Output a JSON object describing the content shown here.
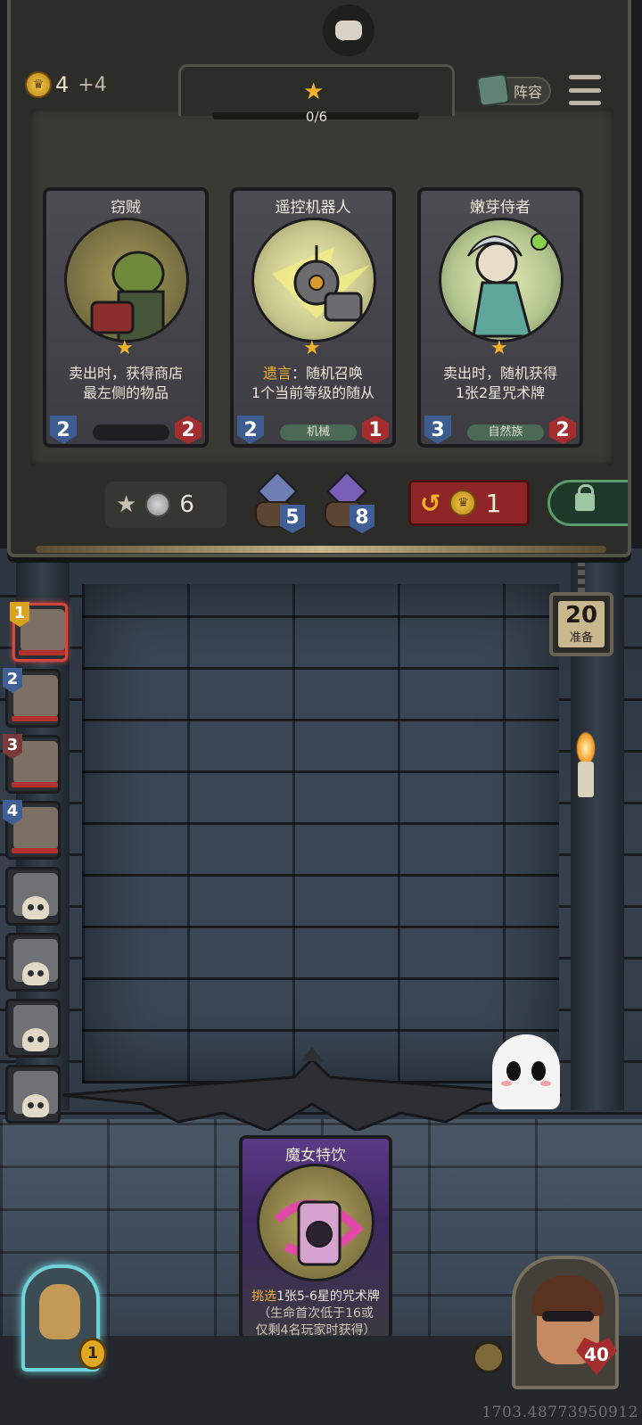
{
  "header": {
    "gold": "4",
    "gold_income": "+4",
    "tier_progress_label": "0/6",
    "tier_progress_fraction": 0.0,
    "lineup_label": "阵容"
  },
  "shop": {
    "cards": [
      {
        "name": "窃贼",
        "text_lines": [
          "卖出时，获得商店",
          "最左侧的物品"
        ],
        "keyword": "",
        "attack": "2",
        "health": "2",
        "tribe": "",
        "stars": 1
      },
      {
        "name": "遥控机器人",
        "keyword": "遗言",
        "text_lines": [
          "：随机召唤",
          "1个当前等级的随从"
        ],
        "attack": "2",
        "health": "1",
        "tribe": "机械",
        "stars": 1
      },
      {
        "name": "嫩芽侍者",
        "text_lines": [
          "卖出时，随机获得",
          "1张2星咒术牌"
        ],
        "keyword": "",
        "attack": "3",
        "health": "2",
        "tribe": "自然族",
        "stars": 1
      }
    ],
    "upgrade_cost": "6",
    "spell_pack_1_cost": "5",
    "spell_pack_2_cost": "8",
    "refresh_cost": "1"
  },
  "players": [
    {
      "rank": "1",
      "current": true,
      "alive": true,
      "rank_color": "#d9a21f"
    },
    {
      "rank": "2",
      "current": false,
      "alive": true,
      "rank_color": "#3f5f96"
    },
    {
      "rank": "3",
      "current": false,
      "alive": true,
      "rank_color": "#7a3a3a"
    },
    {
      "rank": "4",
      "current": false,
      "alive": true,
      "rank_color": "#3f5f96"
    },
    {
      "rank": "",
      "current": false,
      "alive": false
    },
    {
      "rank": "",
      "current": false,
      "alive": false
    },
    {
      "rank": "",
      "current": false,
      "alive": false
    },
    {
      "rank": "",
      "current": false,
      "alive": false
    }
  ],
  "timer": {
    "value": "20",
    "label": "准备"
  },
  "hand_card": {
    "name": "魔女特饮",
    "keyword": "挑选",
    "line1_rest": "1张5-6星的咒术牌",
    "line2": "（生命首次低于16或",
    "line3": "仅剩4名玩家时获得）"
  },
  "hero": {
    "health": "40"
  },
  "treasure": {
    "badge": "1"
  },
  "coords_readout": "1703.48773950912",
  "colors": {
    "accent_gold": "#f2b32b",
    "health_red": "#a32d2f",
    "attack_blue": "#3d5d91"
  }
}
